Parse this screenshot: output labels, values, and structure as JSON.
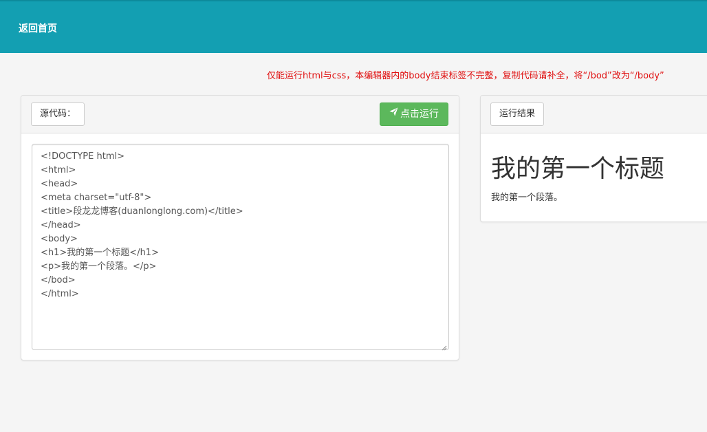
{
  "header": {
    "back_label": "返回首页",
    "bg_color": "#139fb2"
  },
  "notice": {
    "text": "仅能运行html与css，本编辑器内的body结束标签不完整，复制代码请补全，将“/bod”改为“/body”",
    "color": "#e01010"
  },
  "editor": {
    "label": "源代码：",
    "run_label": "点击运行",
    "run_icon": "paper-plane-icon",
    "run_color": "#5cb85c",
    "code_lines": [
      "<!DOCTYPE html>",
      "<html>",
      "<head>",
      "<meta charset=\"utf-8\">",
      "<title>段龙龙博客(duanlonglong.com)</title>",
      "</head>",
      "<body>",
      "<h1>我的第一个标题</h1>",
      "<p>我的第一个段落。</p>",
      "</bod>",
      "</html>"
    ]
  },
  "result": {
    "label": "运行结果",
    "heading": "我的第一个标题",
    "paragraph": "我的第一个段落。"
  }
}
